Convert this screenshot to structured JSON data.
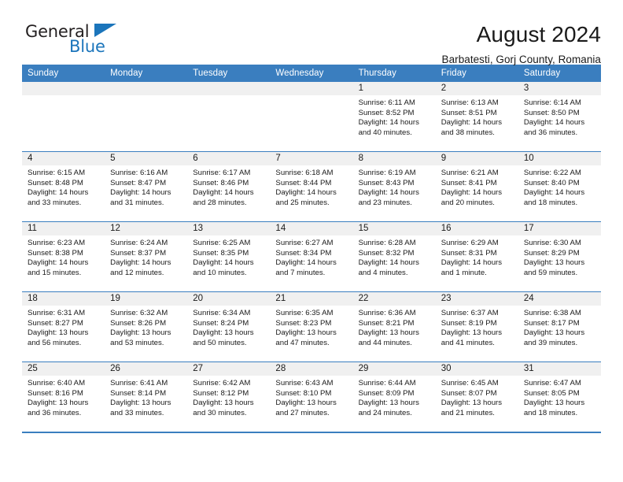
{
  "brand": {
    "name_top": "General",
    "name_bottom": "Blue"
  },
  "header": {
    "title": "August 2024",
    "subtitle": "Barbatesti, Gorj County, Romania"
  },
  "calendar": {
    "weekday_headers": [
      "Sunday",
      "Monday",
      "Tuesday",
      "Wednesday",
      "Thursday",
      "Friday",
      "Saturday"
    ],
    "accent_color": "#3a7ebf",
    "daynum_bg": "#f0f0f0",
    "weeks": [
      [
        {
          "day": "",
          "empty": true
        },
        {
          "day": "",
          "empty": true
        },
        {
          "day": "",
          "empty": true
        },
        {
          "day": "",
          "empty": true
        },
        {
          "day": "1",
          "sunrise": "Sunrise: 6:11 AM",
          "sunset": "Sunset: 8:52 PM",
          "daylight": "Daylight: 14 hours and 40 minutes."
        },
        {
          "day": "2",
          "sunrise": "Sunrise: 6:13 AM",
          "sunset": "Sunset: 8:51 PM",
          "daylight": "Daylight: 14 hours and 38 minutes."
        },
        {
          "day": "3",
          "sunrise": "Sunrise: 6:14 AM",
          "sunset": "Sunset: 8:50 PM",
          "daylight": "Daylight: 14 hours and 36 minutes."
        }
      ],
      [
        {
          "day": "4",
          "sunrise": "Sunrise: 6:15 AM",
          "sunset": "Sunset: 8:48 PM",
          "daylight": "Daylight: 14 hours and 33 minutes."
        },
        {
          "day": "5",
          "sunrise": "Sunrise: 6:16 AM",
          "sunset": "Sunset: 8:47 PM",
          "daylight": "Daylight: 14 hours and 31 minutes."
        },
        {
          "day": "6",
          "sunrise": "Sunrise: 6:17 AM",
          "sunset": "Sunset: 8:46 PM",
          "daylight": "Daylight: 14 hours and 28 minutes."
        },
        {
          "day": "7",
          "sunrise": "Sunrise: 6:18 AM",
          "sunset": "Sunset: 8:44 PM",
          "daylight": "Daylight: 14 hours and 25 minutes."
        },
        {
          "day": "8",
          "sunrise": "Sunrise: 6:19 AM",
          "sunset": "Sunset: 8:43 PM",
          "daylight": "Daylight: 14 hours and 23 minutes."
        },
        {
          "day": "9",
          "sunrise": "Sunrise: 6:21 AM",
          "sunset": "Sunset: 8:41 PM",
          "daylight": "Daylight: 14 hours and 20 minutes."
        },
        {
          "day": "10",
          "sunrise": "Sunrise: 6:22 AM",
          "sunset": "Sunset: 8:40 PM",
          "daylight": "Daylight: 14 hours and 18 minutes."
        }
      ],
      [
        {
          "day": "11",
          "sunrise": "Sunrise: 6:23 AM",
          "sunset": "Sunset: 8:38 PM",
          "daylight": "Daylight: 14 hours and 15 minutes."
        },
        {
          "day": "12",
          "sunrise": "Sunrise: 6:24 AM",
          "sunset": "Sunset: 8:37 PM",
          "daylight": "Daylight: 14 hours and 12 minutes."
        },
        {
          "day": "13",
          "sunrise": "Sunrise: 6:25 AM",
          "sunset": "Sunset: 8:35 PM",
          "daylight": "Daylight: 14 hours and 10 minutes."
        },
        {
          "day": "14",
          "sunrise": "Sunrise: 6:27 AM",
          "sunset": "Sunset: 8:34 PM",
          "daylight": "Daylight: 14 hours and 7 minutes."
        },
        {
          "day": "15",
          "sunrise": "Sunrise: 6:28 AM",
          "sunset": "Sunset: 8:32 PM",
          "daylight": "Daylight: 14 hours and 4 minutes."
        },
        {
          "day": "16",
          "sunrise": "Sunrise: 6:29 AM",
          "sunset": "Sunset: 8:31 PM",
          "daylight": "Daylight: 14 hours and 1 minute."
        },
        {
          "day": "17",
          "sunrise": "Sunrise: 6:30 AM",
          "sunset": "Sunset: 8:29 PM",
          "daylight": "Daylight: 13 hours and 59 minutes."
        }
      ],
      [
        {
          "day": "18",
          "sunrise": "Sunrise: 6:31 AM",
          "sunset": "Sunset: 8:27 PM",
          "daylight": "Daylight: 13 hours and 56 minutes."
        },
        {
          "day": "19",
          "sunrise": "Sunrise: 6:32 AM",
          "sunset": "Sunset: 8:26 PM",
          "daylight": "Daylight: 13 hours and 53 minutes."
        },
        {
          "day": "20",
          "sunrise": "Sunrise: 6:34 AM",
          "sunset": "Sunset: 8:24 PM",
          "daylight": "Daylight: 13 hours and 50 minutes."
        },
        {
          "day": "21",
          "sunrise": "Sunrise: 6:35 AM",
          "sunset": "Sunset: 8:23 PM",
          "daylight": "Daylight: 13 hours and 47 minutes."
        },
        {
          "day": "22",
          "sunrise": "Sunrise: 6:36 AM",
          "sunset": "Sunset: 8:21 PM",
          "daylight": "Daylight: 13 hours and 44 minutes."
        },
        {
          "day": "23",
          "sunrise": "Sunrise: 6:37 AM",
          "sunset": "Sunset: 8:19 PM",
          "daylight": "Daylight: 13 hours and 41 minutes."
        },
        {
          "day": "24",
          "sunrise": "Sunrise: 6:38 AM",
          "sunset": "Sunset: 8:17 PM",
          "daylight": "Daylight: 13 hours and 39 minutes."
        }
      ],
      [
        {
          "day": "25",
          "sunrise": "Sunrise: 6:40 AM",
          "sunset": "Sunset: 8:16 PM",
          "daylight": "Daylight: 13 hours and 36 minutes."
        },
        {
          "day": "26",
          "sunrise": "Sunrise: 6:41 AM",
          "sunset": "Sunset: 8:14 PM",
          "daylight": "Daylight: 13 hours and 33 minutes."
        },
        {
          "day": "27",
          "sunrise": "Sunrise: 6:42 AM",
          "sunset": "Sunset: 8:12 PM",
          "daylight": "Daylight: 13 hours and 30 minutes."
        },
        {
          "day": "28",
          "sunrise": "Sunrise: 6:43 AM",
          "sunset": "Sunset: 8:10 PM",
          "daylight": "Daylight: 13 hours and 27 minutes."
        },
        {
          "day": "29",
          "sunrise": "Sunrise: 6:44 AM",
          "sunset": "Sunset: 8:09 PM",
          "daylight": "Daylight: 13 hours and 24 minutes."
        },
        {
          "day": "30",
          "sunrise": "Sunrise: 6:45 AM",
          "sunset": "Sunset: 8:07 PM",
          "daylight": "Daylight: 13 hours and 21 minutes."
        },
        {
          "day": "31",
          "sunrise": "Sunrise: 6:47 AM",
          "sunset": "Sunset: 8:05 PM",
          "daylight": "Daylight: 13 hours and 18 minutes."
        }
      ]
    ]
  }
}
